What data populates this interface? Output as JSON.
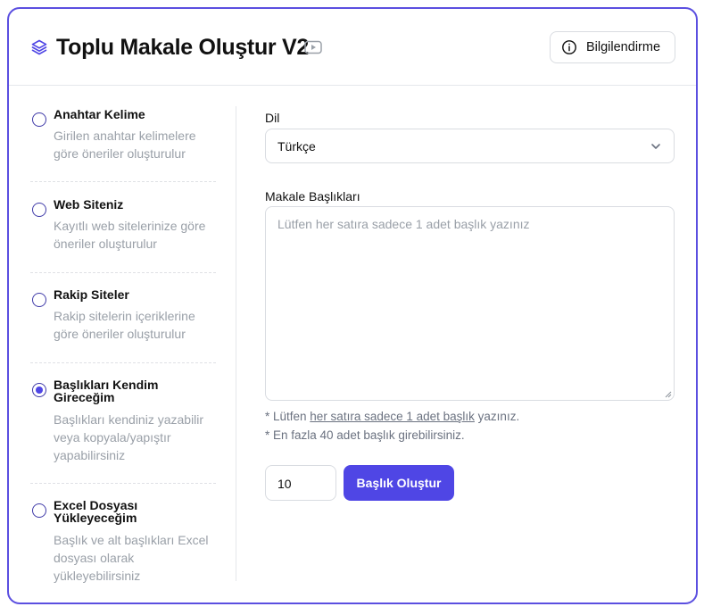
{
  "header": {
    "title": "Toplu Makale Oluştur V2",
    "title_icon": "layers-icon",
    "video_icon": "video-icon",
    "info_button": {
      "label": "Bilgilendirme",
      "icon": "info-icon"
    }
  },
  "sidebar": {
    "options": [
      {
        "title": "Anahtar Kelime",
        "description": "Girilen anahtar kelimelere göre öneriler oluşturulur",
        "selected": false
      },
      {
        "title": "Web Siteniz",
        "description": "Kayıtlı web sitelerinize göre öneriler oluşturulur",
        "selected": false
      },
      {
        "title": "Rakip Siteler",
        "description": "Rakip sitelerin içeriklerine göre öneriler oluşturulur",
        "selected": false
      },
      {
        "title": "Başlıkları Kendim Gireceğim",
        "description": "Başlıkları kendiniz yazabilir veya kopyala/yapıştır yapabilirsiniz",
        "selected": true
      },
      {
        "title": "Excel Dosyası Yükleyeceğim",
        "description": "Başlık ve alt başlıkları Excel dosyası olarak yükleyebilirsiniz",
        "selected": false
      }
    ]
  },
  "form": {
    "language_label": "Dil",
    "language_value": "Türkçe",
    "titles_label": "Makale Başlıkları",
    "titles_placeholder": "Lütfen her satıra sadece 1 adet başlık yazınız",
    "note1_prefix": "* Lütfen ",
    "note1_link": "her satıra sadece 1 adet başlık",
    "note1_suffix": " yazınız.",
    "note2": "* En fazla 40 adet başlık girebilirsiniz.",
    "count_value": "10",
    "submit_label": "Başlık Oluştur"
  },
  "colors": {
    "accent": "#4f46e5",
    "border": "#5b4fe0",
    "muted": "#9aa0a8"
  }
}
